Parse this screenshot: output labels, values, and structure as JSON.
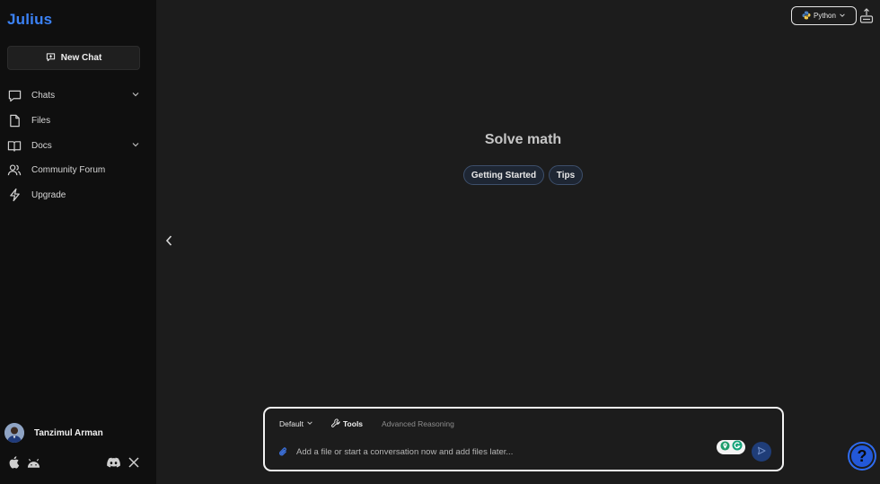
{
  "brand": {
    "name": "Julius"
  },
  "sidebar": {
    "new_chat_label": "New Chat",
    "items": [
      {
        "label": "Chats",
        "icon": "chat-bubble-icon",
        "has_chevron": true
      },
      {
        "label": "Files",
        "icon": "file-icon",
        "has_chevron": false
      },
      {
        "label": "Docs",
        "icon": "book-icon",
        "has_chevron": true
      },
      {
        "label": "Community Forum",
        "icon": "users-icon",
        "has_chevron": false
      },
      {
        "label": "Upgrade",
        "icon": "lightning-icon",
        "has_chevron": false
      }
    ],
    "user": {
      "name": "Tanzimul Arman"
    },
    "bottom_icons": [
      "apple-icon",
      "android-icon",
      "discord-icon",
      "x-icon"
    ]
  },
  "header": {
    "runtime_label": "Python"
  },
  "main": {
    "title": "Solve math",
    "chips": [
      "Getting Started",
      "Tips"
    ]
  },
  "composer": {
    "model_label": "Default",
    "tools_label": "Tools",
    "reasoning_label": "Advanced Reasoning",
    "placeholder": "Add a file or start a conversation now and add files later..."
  },
  "help": {
    "label": "?"
  },
  "colors": {
    "accent": "#3b82f6",
    "sidebar_bg": "#0f0f0f",
    "main_bg": "#1c1c1c"
  }
}
